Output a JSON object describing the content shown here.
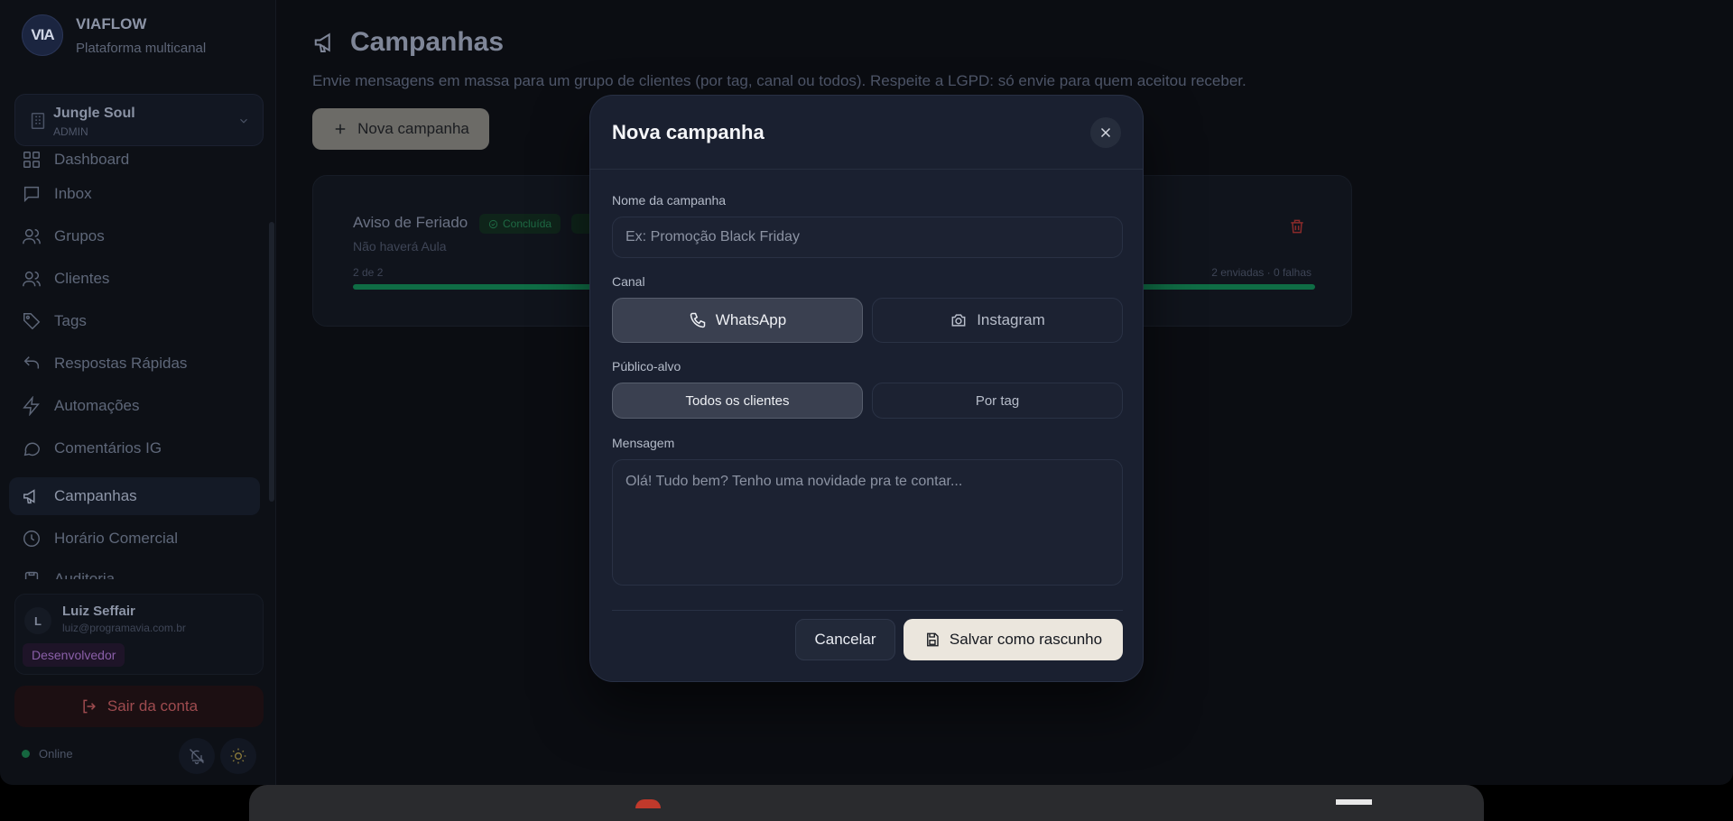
{
  "brand": {
    "logo": "VIA",
    "name": "VIAFLOW",
    "subtitle": "Plataforma multicanal"
  },
  "org": {
    "name": "Jungle Soul",
    "role": "ADMIN"
  },
  "nav": [
    {
      "label": "Dashboard",
      "icon": "grid-icon"
    },
    {
      "label": "Inbox",
      "icon": "message-square-icon"
    },
    {
      "label": "Grupos",
      "icon": "users-icon"
    },
    {
      "label": "Clientes",
      "icon": "users-icon"
    },
    {
      "label": "Tags",
      "icon": "tag-icon"
    },
    {
      "label": "Respostas Rápidas",
      "icon": "reply-icon"
    },
    {
      "label": "Automações",
      "icon": "zap-icon"
    },
    {
      "label": "Comentários IG",
      "icon": "message-circle-icon"
    },
    {
      "label": "Campanhas",
      "icon": "megaphone-icon",
      "active": true
    },
    {
      "label": "Horário Comercial",
      "icon": "clock-icon"
    },
    {
      "label": "Auditoria",
      "icon": "clipboard-icon"
    }
  ],
  "user": {
    "initial": "L",
    "name": "Luiz Seffair",
    "email": "luiz@programavia.com.br",
    "badge": "Desenvolvedor"
  },
  "logout_label": "Sair da conta",
  "status_label": "Online",
  "page": {
    "title": "Campanhas",
    "subtitle": "Envie mensagens em massa para um grupo de clientes (por tag, canal ou todos). Respeite a LGPD: só envie para quem aceitou receber.",
    "new_button": "Nova campanha"
  },
  "campaign": {
    "title": "Aviso de Feriado",
    "status": "Concluída",
    "description": "Não haverá Aula",
    "count": "2 de 2",
    "stats": "2 enviadas · 0 falhas",
    "progress": 1.0
  },
  "modal": {
    "title": "Nova campanha",
    "name_label": "Nome da campanha",
    "name_placeholder": "Ex: Promoção Black Friday",
    "channel_label": "Canal",
    "channels": [
      "WhatsApp",
      "Instagram"
    ],
    "selected_channel": "WhatsApp",
    "audience_label": "Público-alvo",
    "audiences": [
      "Todos os clientes",
      "Por tag"
    ],
    "selected_audience": "Todos os clientes",
    "message_label": "Mensagem",
    "message_placeholder": "Olá! Tudo bem? Tenho uma novidade pra te contar...",
    "cancel_label": "Cancelar",
    "save_label": "Salvar como rascunho"
  },
  "colors": {
    "accent_green": "#0f6d45",
    "danger": "#8a2a2a",
    "primary_button": "#ebe6dd",
    "modal_bg": "#1a2030"
  }
}
